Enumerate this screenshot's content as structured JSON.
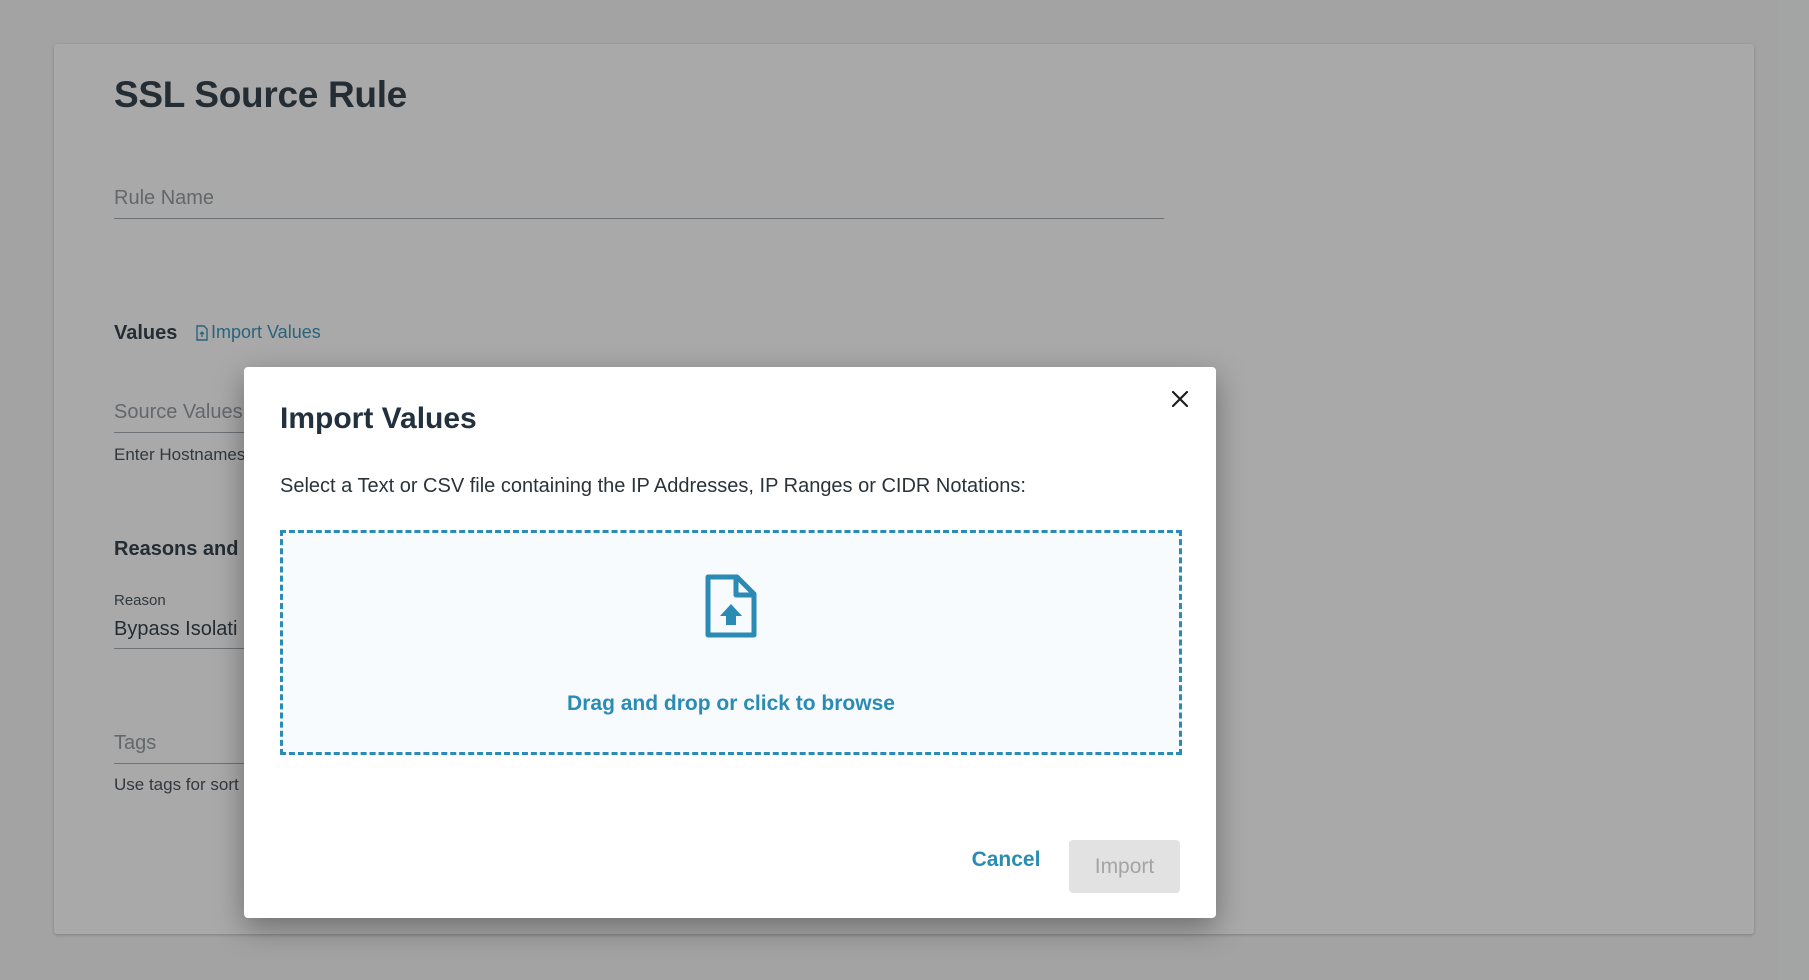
{
  "page": {
    "title": "SSL Source Rule",
    "rule_name_placeholder": "Rule Name",
    "values_heading": "Values",
    "import_values_link": "Import Values",
    "source_values_placeholder": "Source Values",
    "source_values_helper": "Enter Hostnames",
    "reasons_heading": "Reasons and I",
    "reason_label": "Reason",
    "reason_value": "Bypass Isolati",
    "tags_placeholder": "Tags",
    "tags_helper": "Use tags for sort"
  },
  "modal": {
    "title": "Import Values",
    "description": "Select a Text or CSV file containing the IP Addresses, IP Ranges or CIDR Notations:",
    "dropzone_text": "Drag and drop or click to browse",
    "dropzone_icon": "file-upload-icon",
    "close_icon": "close-icon",
    "cancel_label": "Cancel",
    "import_label": "Import",
    "import_disabled": true
  },
  "colors": {
    "accent": "#2a8bb5",
    "title_text": "#22313d",
    "disabled_bg": "#e2e2e2",
    "disabled_text": "#a4a4a4",
    "overlay": "rgba(40,40,40,0.40)"
  }
}
